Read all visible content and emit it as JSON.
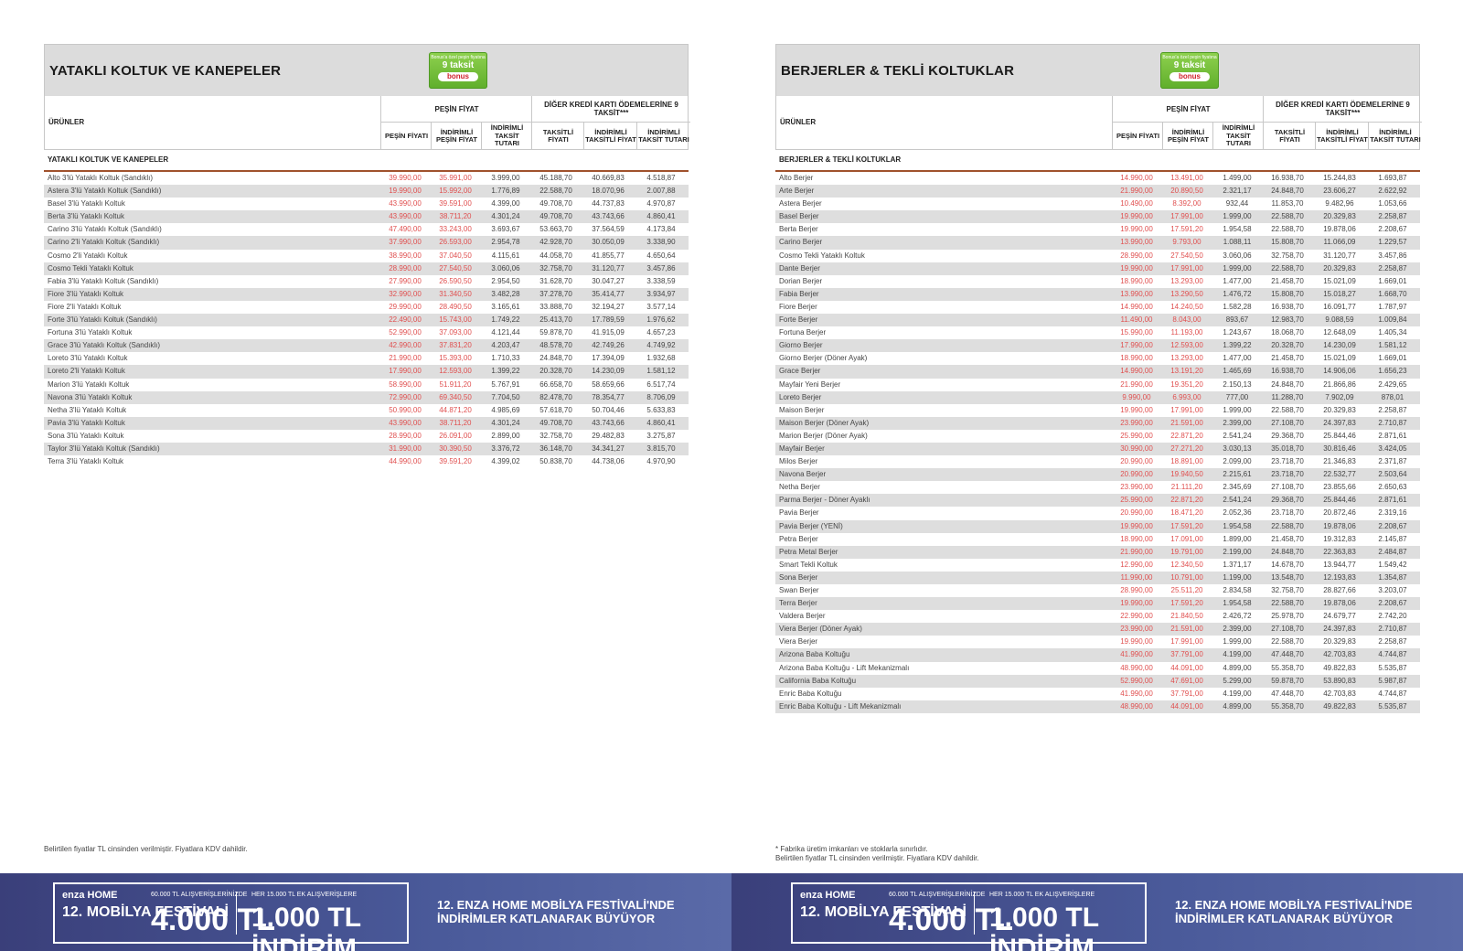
{
  "chart_data": [
    {
      "type": "table",
      "title": "YATAKLI KOLTUK VE KANEPELER",
      "section": "YATAKLI KOLTUK VE KANEPELER",
      "columns": [
        "ÜRÜNLER",
        "PEŞİN FİYATI",
        "İNDİRİMLİ PEŞİN FİYAT",
        "İNDİRİMLİ TAKSİT TUTARI",
        "TAKSİTLİ FİYATI",
        "İNDİRİMLİ TAKSİTLİ FİYAT",
        "İNDİRİMLİ TAKSİT TUTARI"
      ],
      "rows": [
        [
          "Alto 3'lü Yataklı Koltuk (Sandıklı)",
          "39.990,00",
          "35.991,00",
          "3.999,00",
          "45.188,70",
          "40.669,83",
          "4.518,87"
        ],
        [
          "Astera 3'lü Yataklı Koltuk (Sandıklı)",
          "19.990,00",
          "15.992,00",
          "1.776,89",
          "22.588,70",
          "18.070,96",
          "2.007,88"
        ],
        [
          "Basel 3'lü Yataklı Koltuk",
          "43.990,00",
          "39.591,00",
          "4.399,00",
          "49.708,70",
          "44.737,83",
          "4.970,87"
        ],
        [
          "Berta 3'lü Yataklı Koltuk",
          "43.990,00",
          "38.711,20",
          "4.301,24",
          "49.708,70",
          "43.743,66",
          "4.860,41"
        ],
        [
          "Carino 3'lü Yataklı Koltuk (Sandıklı)",
          "47.490,00",
          "33.243,00",
          "3.693,67",
          "53.663,70",
          "37.564,59",
          "4.173,84"
        ],
        [
          "Carino 2'li Yataklı Koltuk (Sandıklı)",
          "37.990,00",
          "26.593,00",
          "2.954,78",
          "42.928,70",
          "30.050,09",
          "3.338,90"
        ],
        [
          "Cosmo 2'li Yataklı Koltuk",
          "38.990,00",
          "37.040,50",
          "4.115,61",
          "44.058,70",
          "41.855,77",
          "4.650,64"
        ],
        [
          "Cosmo Tekli Yataklı Koltuk",
          "28.990,00",
          "27.540,50",
          "3.060,06",
          "32.758,70",
          "31.120,77",
          "3.457,86"
        ],
        [
          "Fabia 3'lü Yataklı Koltuk (Sandıklı)",
          "27.990,00",
          "26.590,50",
          "2.954,50",
          "31.628,70",
          "30.047,27",
          "3.338,59"
        ],
        [
          "Fiore 3'lü Yataklı Koltuk",
          "32.990,00",
          "31.340,50",
          "3.482,28",
          "37.278,70",
          "35.414,77",
          "3.934,97"
        ],
        [
          "Fiore 2'li Yataklı Koltuk",
          "29.990,00",
          "28.490,50",
          "3.165,61",
          "33.888,70",
          "32.194,27",
          "3.577,14"
        ],
        [
          "Forte 3'lü Yataklı Koltuk (Sandıklı)",
          "22.490,00",
          "15.743,00",
          "1.749,22",
          "25.413,70",
          "17.789,59",
          "1.976,62"
        ],
        [
          "Fortuna 3'lü Yataklı Koltuk",
          "52.990,00",
          "37.093,00",
          "4.121,44",
          "59.878,70",
          "41.915,09",
          "4.657,23"
        ],
        [
          "Grace 3'lü Yataklı Koltuk (Sandıklı)",
          "42.990,00",
          "37.831,20",
          "4.203,47",
          "48.578,70",
          "42.749,26",
          "4.749,92"
        ],
        [
          "Loreto 3'lü Yataklı Koltuk",
          "21.990,00",
          "15.393,00",
          "1.710,33",
          "24.848,70",
          "17.394,09",
          "1.932,68"
        ],
        [
          "Loreto 2'li Yataklı Koltuk",
          "17.990,00",
          "12.593,00",
          "1.399,22",
          "20.328,70",
          "14.230,09",
          "1.581,12"
        ],
        [
          "Marion 3'lü Yataklı Koltuk",
          "58.990,00",
          "51.911,20",
          "5.767,91",
          "66.658,70",
          "58.659,66",
          "6.517,74"
        ],
        [
          "Navona 3'lü Yataklı Koltuk",
          "72.990,00",
          "69.340,50",
          "7.704,50",
          "82.478,70",
          "78.354,77",
          "8.706,09"
        ],
        [
          "Netha 3'lü Yataklı Koltuk",
          "50.990,00",
          "44.871,20",
          "4.985,69",
          "57.618,70",
          "50.704,46",
          "5.633,83"
        ],
        [
          "Pavia 3'lü Yataklı Koltuk",
          "43.990,00",
          "38.711,20",
          "4.301,24",
          "49.708,70",
          "43.743,66",
          "4.860,41"
        ],
        [
          "Sona 3'lü Yataklı Koltuk",
          "28.990,00",
          "26.091,00",
          "2.899,00",
          "32.758,70",
          "29.482,83",
          "3.275,87"
        ],
        [
          "Taylor 3'lü Yataklı Koltuk (Sandıklı)",
          "31.990,00",
          "30.390,50",
          "3.376,72",
          "36.148,70",
          "34.341,27",
          "3.815,70"
        ],
        [
          "Terra 3'lü Yataklı Koltuk",
          "44.990,00",
          "39.591,20",
          "4.399,02",
          "50.838,70",
          "44.738,06",
          "4.970,90"
        ]
      ]
    },
    {
      "type": "table",
      "title": "BERJERLER & TEKLİ KOLTUKLAR",
      "section": "BERJERLER & TEKLİ KOLTUKLAR",
      "columns": [
        "ÜRÜNLER",
        "PEŞİN FİYATI",
        "İNDİRİMLİ PEŞİN FİYAT",
        "İNDİRİMLİ TAKSİT TUTARI",
        "TAKSİTLİ FİYATI",
        "İNDİRİMLİ TAKSİTLİ FİYAT",
        "İNDİRİMLİ TAKSİT TUTARI"
      ],
      "rows": [
        [
          "Alto Berjer",
          "14.990,00",
          "13.491,00",
          "1.499,00",
          "16.938,70",
          "15.244,83",
          "1.693,87"
        ],
        [
          "Arte Berjer",
          "21.990,00",
          "20.890,50",
          "2.321,17",
          "24.848,70",
          "23.606,27",
          "2.622,92"
        ],
        [
          "Astera Berjer",
          "10.490,00",
          "8.392,00",
          "932,44",
          "11.853,70",
          "9.482,96",
          "1.053,66"
        ],
        [
          "Basel Berjer",
          "19.990,00",
          "17.991,00",
          "1.999,00",
          "22.588,70",
          "20.329,83",
          "2.258,87"
        ],
        [
          "Berta Berjer",
          "19.990,00",
          "17.591,20",
          "1.954,58",
          "22.588,70",
          "19.878,06",
          "2.208,67"
        ],
        [
          "Carino Berjer",
          "13.990,00",
          "9.793,00",
          "1.088,11",
          "15.808,70",
          "11.066,09",
          "1.229,57"
        ],
        [
          "Cosmo Tekli Yataklı Koltuk",
          "28.990,00",
          "27.540,50",
          "3.060,06",
          "32.758,70",
          "31.120,77",
          "3.457,86"
        ],
        [
          "Dante Berjer",
          "19.990,00",
          "17.991,00",
          "1.999,00",
          "22.588,70",
          "20.329,83",
          "2.258,87"
        ],
        [
          "Dorian Berjer",
          "18.990,00",
          "13.293,00",
          "1.477,00",
          "21.458,70",
          "15.021,09",
          "1.669,01"
        ],
        [
          "Fabia Berjer",
          "13.990,00",
          "13.290,50",
          "1.476,72",
          "15.808,70",
          "15.018,27",
          "1.668,70"
        ],
        [
          "Fiore Berjer",
          "14.990,00",
          "14.240,50",
          "1.582,28",
          "16.938,70",
          "16.091,77",
          "1.787,97"
        ],
        [
          "Forte Berjer",
          "11.490,00",
          "8.043,00",
          "893,67",
          "12.983,70",
          "9.088,59",
          "1.009,84"
        ],
        [
          "Fortuna Berjer",
          "15.990,00",
          "11.193,00",
          "1.243,67",
          "18.068,70",
          "12.648,09",
          "1.405,34"
        ],
        [
          "Giorno Berjer",
          "17.990,00",
          "12.593,00",
          "1.399,22",
          "20.328,70",
          "14.230,09",
          "1.581,12"
        ],
        [
          "Giorno Berjer (Döner Ayak)",
          "18.990,00",
          "13.293,00",
          "1.477,00",
          "21.458,70",
          "15.021,09",
          "1.669,01"
        ],
        [
          "Grace Berjer",
          "14.990,00",
          "13.191,20",
          "1.465,69",
          "16.938,70",
          "14.906,06",
          "1.656,23"
        ],
        [
          "Mayfair Yeni Berjer",
          "21.990,00",
          "19.351,20",
          "2.150,13",
          "24.848,70",
          "21.866,86",
          "2.429,65"
        ],
        [
          "Loreto Berjer",
          "9.990,00",
          "6.993,00",
          "777,00",
          "11.288,70",
          "7.902,09",
          "878,01"
        ],
        [
          "Maison Berjer",
          "19.990,00",
          "17.991,00",
          "1.999,00",
          "22.588,70",
          "20.329,83",
          "2.258,87"
        ],
        [
          "Maison Berjer (Döner Ayak)",
          "23.990,00",
          "21.591,00",
          "2.399,00",
          "27.108,70",
          "24.397,83",
          "2.710,87"
        ],
        [
          "Marion Berjer (Döner Ayak)",
          "25.990,00",
          "22.871,20",
          "2.541,24",
          "29.368,70",
          "25.844,46",
          "2.871,61"
        ],
        [
          "Mayfair Berjer",
          "30.990,00",
          "27.271,20",
          "3.030,13",
          "35.018,70",
          "30.816,46",
          "3.424,05"
        ],
        [
          "Milos Berjer",
          "20.990,00",
          "18.891,00",
          "2.099,00",
          "23.718,70",
          "21.346,83",
          "2.371,87"
        ],
        [
          "Navona Berjer",
          "20.990,00",
          "19.940,50",
          "2.215,61",
          "23.718,70",
          "22.532,77",
          "2.503,64"
        ],
        [
          "Netha Berjer",
          "23.990,00",
          "21.111,20",
          "2.345,69",
          "27.108,70",
          "23.855,66",
          "2.650,63"
        ],
        [
          "Parma Berjer - Döner Ayaklı",
          "25.990,00",
          "22.871,20",
          "2.541,24",
          "29.368,70",
          "25.844,46",
          "2.871,61"
        ],
        [
          "Pavia Berjer",
          "20.990,00",
          "18.471,20",
          "2.052,36",
          "23.718,70",
          "20.872,46",
          "2.319,16"
        ],
        [
          "Pavia Berjer (YENİ)",
          "19.990,00",
          "17.591,20",
          "1.954,58",
          "22.588,70",
          "19.878,06",
          "2.208,67"
        ],
        [
          "Petra Berjer",
          "18.990,00",
          "17.091,00",
          "1.899,00",
          "21.458,70",
          "19.312,83",
          "2.145,87"
        ],
        [
          "Petra Metal Berjer",
          "21.990,00",
          "19.791,00",
          "2.199,00",
          "24.848,70",
          "22.363,83",
          "2.484,87"
        ],
        [
          "Smart Tekli Koltuk",
          "12.990,00",
          "12.340,50",
          "1.371,17",
          "14.678,70",
          "13.944,77",
          "1.549,42"
        ],
        [
          "Sona Berjer",
          "11.990,00",
          "10.791,00",
          "1.199,00",
          "13.548,70",
          "12.193,83",
          "1.354,87"
        ],
        [
          "Swan Berjer",
          "28.990,00",
          "25.511,20",
          "2.834,58",
          "32.758,70",
          "28.827,66",
          "3.203,07"
        ],
        [
          "Terra Berjer",
          "19.990,00",
          "17.591,20",
          "1.954,58",
          "22.588,70",
          "19.878,06",
          "2.208,67"
        ],
        [
          "Valdera Berjer",
          "22.990,00",
          "21.840,50",
          "2.426,72",
          "25.978,70",
          "24.679,77",
          "2.742,20"
        ],
        [
          "Viera Berjer (Döner Ayak)",
          "23.990,00",
          "21.591,00",
          "2.399,00",
          "27.108,70",
          "24.397,83",
          "2.710,87"
        ],
        [
          "Viera Berjer",
          "19.990,00",
          "17.991,00",
          "1.999,00",
          "22.588,70",
          "20.329,83",
          "2.258,87"
        ],
        [
          "Arizona Baba Koltuğu",
          "41.990,00",
          "37.791,00",
          "4.199,00",
          "47.448,70",
          "42.703,83",
          "4.744,87"
        ],
        [
          "Arizona Baba Koltuğu - Lift Mekanizmalı",
          "48.990,00",
          "44.091,00",
          "4.899,00",
          "55.358,70",
          "49.822,83",
          "5.535,87"
        ],
        [
          "California Baba Koltuğu",
          "52.990,00",
          "47.691,00",
          "5.299,00",
          "59.878,70",
          "53.890,83",
          "5.987,87"
        ],
        [
          "Enric Baba Koltuğu",
          "41.990,00",
          "37.791,00",
          "4.199,00",
          "47.448,70",
          "42.703,83",
          "4.744,87"
        ],
        [
          "Enric Baba Koltuğu - Lift Mekanizmalı",
          "48.990,00",
          "44.091,00",
          "4.899,00",
          "55.358,70",
          "49.822,83",
          "5.535,87"
        ]
      ]
    }
  ],
  "headers": {
    "urunler": "ÜRÜNLER",
    "pesin_group": "PEŞİN FİYAT",
    "kredi_group": "DİĞER KREDİ KARTI ÖDEMELERİNE 9 TAKSİT***",
    "sub": [
      "PEŞİN FİYATI",
      "İNDİRİMLİ PEŞİN FİYAT",
      "İNDİRİMLİ TAKSİT TUTARI",
      "TAKSİTLİ FİYATI",
      "İNDİRİMLİ TAKSİTLİ FİYAT",
      "İNDİRİMLİ TAKSİT TUTARI"
    ]
  },
  "promo": {
    "line1": "Bonus'a özel peşin fiyatına",
    "line2": "9 taksit",
    "brand": "bonus"
  },
  "footnotes": {
    "left": "Belirtilen fiyatlar TL cinsinden verilmiştir. Fiyatlara KDV dahildir.",
    "right_1": "* Fabrika üretim imkanları ve stoklarla sınırlıdır.",
    "right_2": "Belirtilen fiyatlar TL cinsinden verilmiştir. Fiyatlara KDV dahildir."
  },
  "banner": {
    "logo": "enza HOME",
    "festival": "12. MOBİLYA FESTİVALİ",
    "offer1_small": "60.000 TL ALIŞVERİŞLERİNİZDE",
    "offer1_big": "4.000 TL",
    "offer2_small": "HER 15.000 TL EK ALIŞVERİŞLERE",
    "offer2_big": "1.000 TL İNDİRİM",
    "tagline": "12. ENZA HOME MOBİLYA FESTİVALİ'NDE İNDİRİMLER KATLANARAK BÜYÜYOR"
  },
  "colors": {
    "red_price": "#e05050",
    "row_stripe": "#dedede",
    "header_bg": "#dcdcdc",
    "banner": "#3f4a8a",
    "promo_green": "#6fbf3a"
  }
}
